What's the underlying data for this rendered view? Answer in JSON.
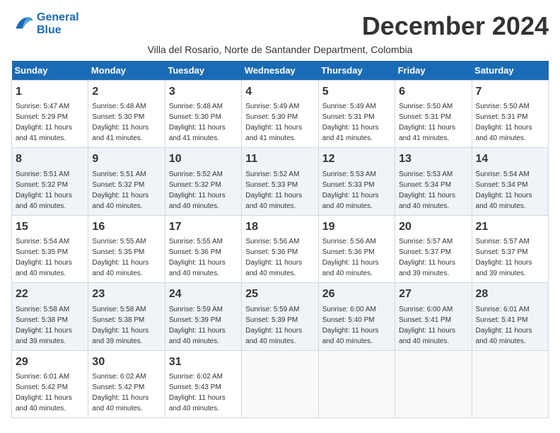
{
  "logo": {
    "line1": "General",
    "line2": "Blue"
  },
  "title": "December 2024",
  "subtitle": "Villa del Rosario, Norte de Santander Department, Colombia",
  "weekdays": [
    "Sunday",
    "Monday",
    "Tuesday",
    "Wednesday",
    "Thursday",
    "Friday",
    "Saturday"
  ],
  "weeks": [
    [
      {
        "day": "1",
        "sunrise": "5:47 AM",
        "sunset": "5:29 PM",
        "daylight": "11 hours and 41 minutes."
      },
      {
        "day": "2",
        "sunrise": "5:48 AM",
        "sunset": "5:30 PM",
        "daylight": "11 hours and 41 minutes."
      },
      {
        "day": "3",
        "sunrise": "5:48 AM",
        "sunset": "5:30 PM",
        "daylight": "11 hours and 41 minutes."
      },
      {
        "day": "4",
        "sunrise": "5:49 AM",
        "sunset": "5:30 PM",
        "daylight": "11 hours and 41 minutes."
      },
      {
        "day": "5",
        "sunrise": "5:49 AM",
        "sunset": "5:31 PM",
        "daylight": "11 hours and 41 minutes."
      },
      {
        "day": "6",
        "sunrise": "5:50 AM",
        "sunset": "5:31 PM",
        "daylight": "11 hours and 41 minutes."
      },
      {
        "day": "7",
        "sunrise": "5:50 AM",
        "sunset": "5:31 PM",
        "daylight": "11 hours and 40 minutes."
      }
    ],
    [
      {
        "day": "8",
        "sunrise": "5:51 AM",
        "sunset": "5:32 PM",
        "daylight": "11 hours and 40 minutes."
      },
      {
        "day": "9",
        "sunrise": "5:51 AM",
        "sunset": "5:32 PM",
        "daylight": "11 hours and 40 minutes."
      },
      {
        "day": "10",
        "sunrise": "5:52 AM",
        "sunset": "5:32 PM",
        "daylight": "11 hours and 40 minutes."
      },
      {
        "day": "11",
        "sunrise": "5:52 AM",
        "sunset": "5:33 PM",
        "daylight": "11 hours and 40 minutes."
      },
      {
        "day": "12",
        "sunrise": "5:53 AM",
        "sunset": "5:33 PM",
        "daylight": "11 hours and 40 minutes."
      },
      {
        "day": "13",
        "sunrise": "5:53 AM",
        "sunset": "5:34 PM",
        "daylight": "11 hours and 40 minutes."
      },
      {
        "day": "14",
        "sunrise": "5:54 AM",
        "sunset": "5:34 PM",
        "daylight": "11 hours and 40 minutes."
      }
    ],
    [
      {
        "day": "15",
        "sunrise": "5:54 AM",
        "sunset": "5:35 PM",
        "daylight": "11 hours and 40 minutes."
      },
      {
        "day": "16",
        "sunrise": "5:55 AM",
        "sunset": "5:35 PM",
        "daylight": "11 hours and 40 minutes."
      },
      {
        "day": "17",
        "sunrise": "5:55 AM",
        "sunset": "5:36 PM",
        "daylight": "11 hours and 40 minutes."
      },
      {
        "day": "18",
        "sunrise": "5:56 AM",
        "sunset": "5:36 PM",
        "daylight": "11 hours and 40 minutes."
      },
      {
        "day": "19",
        "sunrise": "5:56 AM",
        "sunset": "5:36 PM",
        "daylight": "11 hours and 40 minutes."
      },
      {
        "day": "20",
        "sunrise": "5:57 AM",
        "sunset": "5:37 PM",
        "daylight": "11 hours and 39 minutes."
      },
      {
        "day": "21",
        "sunrise": "5:57 AM",
        "sunset": "5:37 PM",
        "daylight": "11 hours and 39 minutes."
      }
    ],
    [
      {
        "day": "22",
        "sunrise": "5:58 AM",
        "sunset": "5:38 PM",
        "daylight": "11 hours and 39 minutes."
      },
      {
        "day": "23",
        "sunrise": "5:58 AM",
        "sunset": "5:38 PM",
        "daylight": "11 hours and 39 minutes."
      },
      {
        "day": "24",
        "sunrise": "5:59 AM",
        "sunset": "5:39 PM",
        "daylight": "11 hours and 40 minutes."
      },
      {
        "day": "25",
        "sunrise": "5:59 AM",
        "sunset": "5:39 PM",
        "daylight": "11 hours and 40 minutes."
      },
      {
        "day": "26",
        "sunrise": "6:00 AM",
        "sunset": "5:40 PM",
        "daylight": "11 hours and 40 minutes."
      },
      {
        "day": "27",
        "sunrise": "6:00 AM",
        "sunset": "5:41 PM",
        "daylight": "11 hours and 40 minutes."
      },
      {
        "day": "28",
        "sunrise": "6:01 AM",
        "sunset": "5:41 PM",
        "daylight": "11 hours and 40 minutes."
      }
    ],
    [
      {
        "day": "29",
        "sunrise": "6:01 AM",
        "sunset": "5:42 PM",
        "daylight": "11 hours and 40 minutes."
      },
      {
        "day": "30",
        "sunrise": "6:02 AM",
        "sunset": "5:42 PM",
        "daylight": "11 hours and 40 minutes."
      },
      {
        "day": "31",
        "sunrise": "6:02 AM",
        "sunset": "5:43 PM",
        "daylight": "11 hours and 40 minutes."
      },
      null,
      null,
      null,
      null
    ]
  ]
}
